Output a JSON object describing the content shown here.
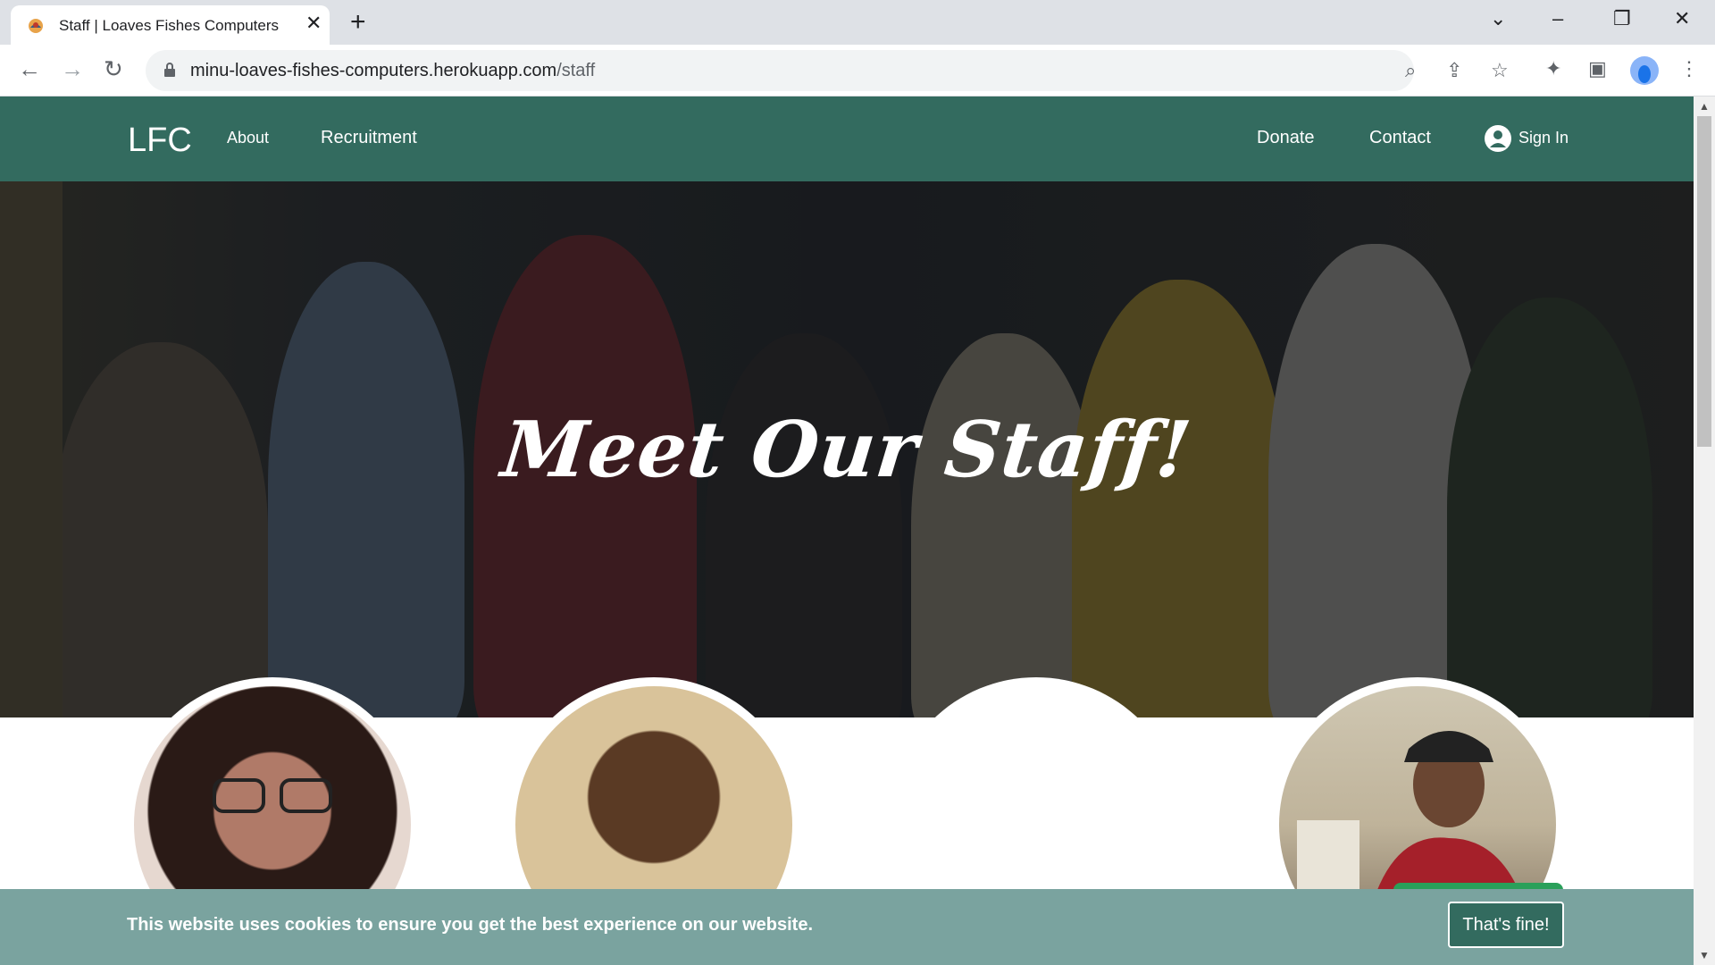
{
  "browser": {
    "tab_title": "Staff | Loaves Fishes Computers",
    "tab_close": "✕",
    "new_tab": "+",
    "url_host": "minu-loaves-fishes-computers.herokuapp.com",
    "url_path": "/staff",
    "icons": [
      "back-icon",
      "forward-icon",
      "reload-icon",
      "lock-icon",
      "zoom-icon",
      "share-icon",
      "star-icon",
      "extensions-icon",
      "sidepanel-icon",
      "profile-icon",
      "menu-icon"
    ]
  },
  "site": {
    "brand": "LFC",
    "nav_left": [
      "About",
      "Recruitment"
    ],
    "nav_right": [
      "Donate",
      "Contact"
    ],
    "sign_in": "Sign In",
    "colors": {
      "nav": "#336b5f",
      "cookie_bar": "#7aa39f"
    }
  },
  "hero": {
    "title": "Meet Our Staff!"
  },
  "staff": {
    "photo_count_visible": 4
  },
  "cookie": {
    "message": "This website uses cookies to ensure you get the best experience on our website.",
    "button": "That's fine!"
  }
}
